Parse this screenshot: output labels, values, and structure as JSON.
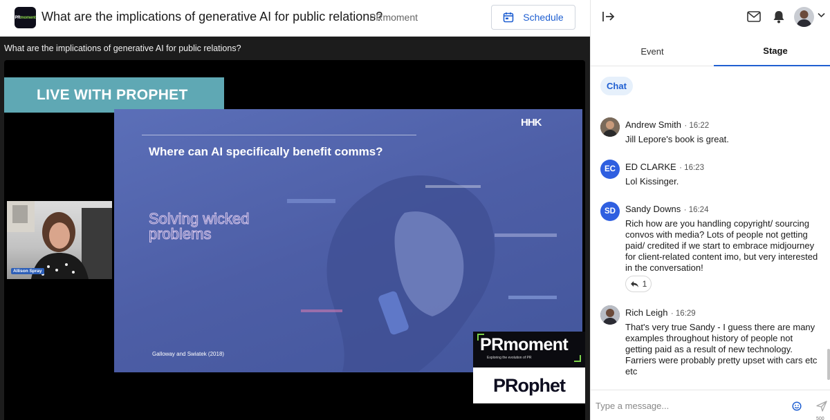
{
  "header": {
    "logo_text": "PRmoment",
    "title": "What are the implications of generative AI for public relations?",
    "org": "PRmoment",
    "schedule_label": "Schedule"
  },
  "stage": {
    "title": "What are the implications of generative AI for public relations?",
    "banner": "LIVE WITH PROPHET",
    "slide": {
      "heading": "Where can AI specifically benefit comms?",
      "mark": "HHK",
      "big_text": "Solving wicked problems",
      "credit": "Galloway and Swiatek (2018)"
    },
    "speaker_name": "Allison Spray",
    "pr_logo": {
      "main": "PRmoment",
      "tagline": "Exploring the evolution of PR"
    },
    "prophet_logo": "PRophet"
  },
  "sidebar": {
    "tabs": [
      {
        "label": "Event",
        "active": false
      },
      {
        "label": "Stage",
        "active": true
      }
    ],
    "chat_label": "Chat",
    "messages": [
      {
        "author": "Andrew Smith",
        "time": "· 16:22",
        "text": "Jill Lepore's book is great.",
        "avatar": "photo"
      },
      {
        "author": "ED CLARKE",
        "time": "· 16:23",
        "text": "Lol Kissinger.",
        "initials": "EC",
        "avatar_color": "#2f5fe0"
      },
      {
        "author": "Sandy Downs",
        "time": "· 16:24",
        "text": "Rich how are you handling copyright/ sourcing convos with media? Lots of people not getting paid/ credited if we start to embrace midjourney for client-related content imo, but very interested in the conversation!",
        "initials": "SD",
        "avatar_color": "#2f5fe0",
        "replies": "1"
      },
      {
        "author": "Rich Leigh",
        "time": "· 16:29",
        "text": "That's very true Sandy - I guess there are many examples throughout history of people not getting paid as a result of new technology. Farriers were probably pretty upset with cars etc etc",
        "avatar": "photo"
      }
    ],
    "composer": {
      "placeholder": "Type a message...",
      "char_count": "500"
    }
  },
  "colors": {
    "accent": "#1f5fd1",
    "banner": "#5fa8b4",
    "slide": "#4d5ea6",
    "initials_avatar": "#2f5fe0"
  },
  "icons": [
    "calendar-icon",
    "collapse-panel-icon",
    "mail-icon",
    "bell-icon",
    "chevron-down-icon",
    "reply-icon",
    "emoji-icon",
    "send-icon"
  ]
}
